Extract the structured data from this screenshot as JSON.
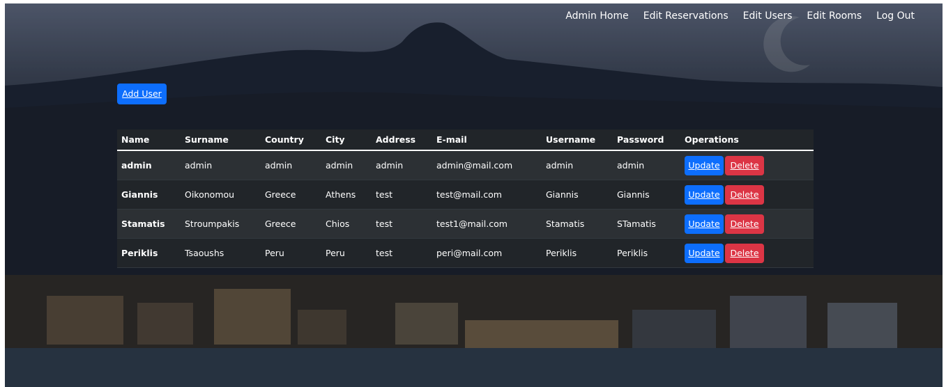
{
  "nav": {
    "items": [
      {
        "label": "Admin Home"
      },
      {
        "label": "Edit Reservations"
      },
      {
        "label": "Edit Users"
      },
      {
        "label": "Edit Rooms"
      },
      {
        "label": "Log Out"
      }
    ]
  },
  "actions": {
    "add_user": "Add User"
  },
  "table": {
    "headers": [
      "Name",
      "Surname",
      "Country",
      "City",
      "Address",
      "E-mail",
      "Username",
      "Password",
      "Operations"
    ],
    "rows": [
      {
        "name": "admin",
        "surname": "admin",
        "country": "admin",
        "city": "admin",
        "address": "admin",
        "email": "admin@mail.com",
        "username": "admin",
        "password": "admin"
      },
      {
        "name": "Giannis",
        "surname": "Oikonomou",
        "country": "Greece",
        "city": "Athens",
        "address": "test",
        "email": "test@mail.com",
        "username": "Giannis",
        "password": "Giannis"
      },
      {
        "name": "Stamatis",
        "surname": "Stroumpakis",
        "country": "Greece",
        "city": "Chios",
        "address": "test",
        "email": "test1@mail.com",
        "username": "Stamatis",
        "password": "STamatis"
      },
      {
        "name": "Periklis",
        "surname": "Tsaoushs",
        "country": "Peru",
        "city": "Peru",
        "address": "test",
        "email": "peri@mail.com",
        "username": "Periklis",
        "password": "Periklis"
      }
    ],
    "update_label": "Update",
    "delete_label": "Delete"
  },
  "colors": {
    "primary": "#0d6efd",
    "danger": "#dc3545",
    "table_dark": "#212529",
    "table_striped": "#2c3034",
    "text": "#ffffff"
  }
}
